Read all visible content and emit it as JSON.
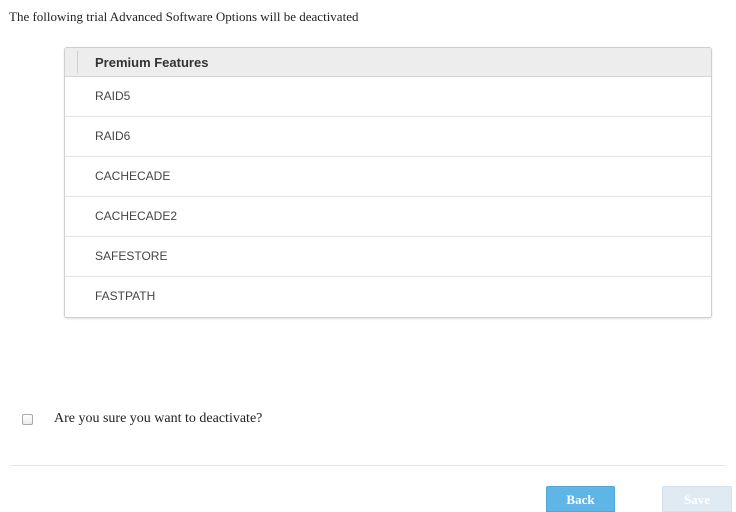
{
  "intro_text": "The following trial Advanced Software Options will be deactivated",
  "features_table": {
    "header": "Premium Features",
    "rows": [
      "RAID5",
      "RAID6",
      "CACHECADE",
      "CACHECADE2",
      "SAFESTORE",
      "FASTPATH"
    ]
  },
  "confirm": {
    "label": "Are you sure you want to deactivate?",
    "checked": false
  },
  "buttons": {
    "back_label": "Back",
    "save_label": "Save"
  },
  "colors": {
    "back_button": "#5fb6e6",
    "save_button_disabled": "#dfeaf2",
    "header_background": "#ededed"
  }
}
